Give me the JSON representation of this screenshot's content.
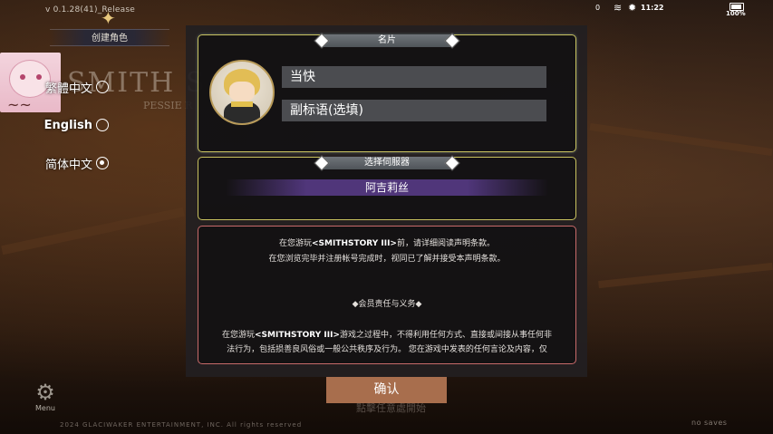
{
  "version": "v 0.1.28(41)_Release",
  "title": "创建角色",
  "status_bar": {
    "notif": "0",
    "time": "11:22",
    "battery": "100%"
  },
  "background": {
    "logo": "SMITH S",
    "logo_sub": "PESSIE R"
  },
  "languages": [
    {
      "label": "繁體中文",
      "selected": false
    },
    {
      "label": "English",
      "selected": false
    },
    {
      "label": "简体中文",
      "selected": true
    }
  ],
  "name_card": {
    "header": "名片",
    "name_value": "当快",
    "subtitle_placeholder": "副标语(选填)"
  },
  "server_card": {
    "header": "选择伺服器",
    "server_name": "阿吉莉丝"
  },
  "terms": {
    "line1_pre": "在您游玩",
    "game_name": "<SMITHSTORY III>",
    "line1_post": "前，请详细阅读声明条款。",
    "line2": "在您浏览完毕并注册帐号完成时，视同已了解并接受本声明条款。",
    "section_title": "◆会员责任与义务◆",
    "para_pre": "在您游玩",
    "para_post": "游戏之过程中，不得利用任何方式、直接或间接从事任何非",
    "para_line2": "法行为，包括损善良风俗或一般公共秩序及行为。 您在游戏中发表的任何言论及内容，仅"
  },
  "confirm_label": "确认",
  "start_hint": "點擊任意處開始",
  "menu_label": "Menu",
  "copyright": "2024 GLACIWAKER ENTERTAINMENT, INC. All rights reserved",
  "no_saves": "no saves"
}
